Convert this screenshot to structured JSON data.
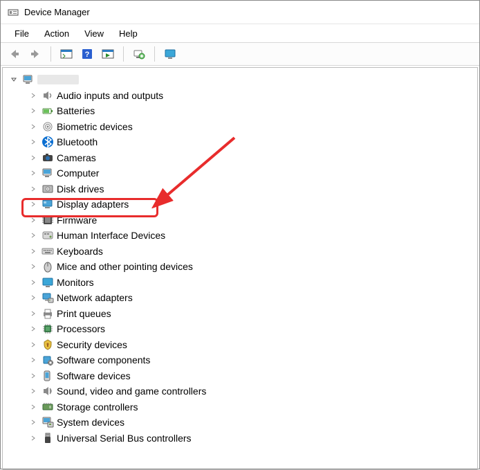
{
  "window": {
    "title": "Device Manager"
  },
  "menu": {
    "file": "File",
    "action": "Action",
    "view": "View",
    "help": "Help"
  },
  "toolbar": {
    "back": "Back",
    "forward": "Forward",
    "show_hide": "Show/Hide Console Tree",
    "help": "Help",
    "action_menu": "Action",
    "scan": "Scan for hardware changes",
    "monitor": "Add legacy hardware"
  },
  "root": {
    "label": ""
  },
  "nodes": [
    {
      "label": "Audio inputs and outputs",
      "icon": "speaker"
    },
    {
      "label": "Batteries",
      "icon": "battery"
    },
    {
      "label": "Biometric devices",
      "icon": "fingerprint"
    },
    {
      "label": "Bluetooth",
      "icon": "bluetooth"
    },
    {
      "label": "Cameras",
      "icon": "camera"
    },
    {
      "label": "Computer",
      "icon": "computer"
    },
    {
      "label": "Disk drives",
      "icon": "disk"
    },
    {
      "label": "Display adapters",
      "icon": "display-adapter"
    },
    {
      "label": "Firmware",
      "icon": "firmware"
    },
    {
      "label": "Human Interface Devices",
      "icon": "hid"
    },
    {
      "label": "Keyboards",
      "icon": "keyboard"
    },
    {
      "label": "Mice and other pointing devices",
      "icon": "mouse"
    },
    {
      "label": "Monitors",
      "icon": "monitor"
    },
    {
      "label": "Network adapters",
      "icon": "network"
    },
    {
      "label": "Print queues",
      "icon": "printer"
    },
    {
      "label": "Processors",
      "icon": "cpu"
    },
    {
      "label": "Security devices",
      "icon": "security"
    },
    {
      "label": "Software components",
      "icon": "sw-component"
    },
    {
      "label": "Software devices",
      "icon": "sw-device"
    },
    {
      "label": "Sound, video and game controllers",
      "icon": "sound"
    },
    {
      "label": "Storage controllers",
      "icon": "storage"
    },
    {
      "label": "System devices",
      "icon": "system"
    },
    {
      "label": "Universal Serial Bus controllers",
      "icon": "usb"
    }
  ],
  "annotation": {
    "highlighted_node": "Display adapters",
    "highlight_color": "#e82c2c"
  }
}
